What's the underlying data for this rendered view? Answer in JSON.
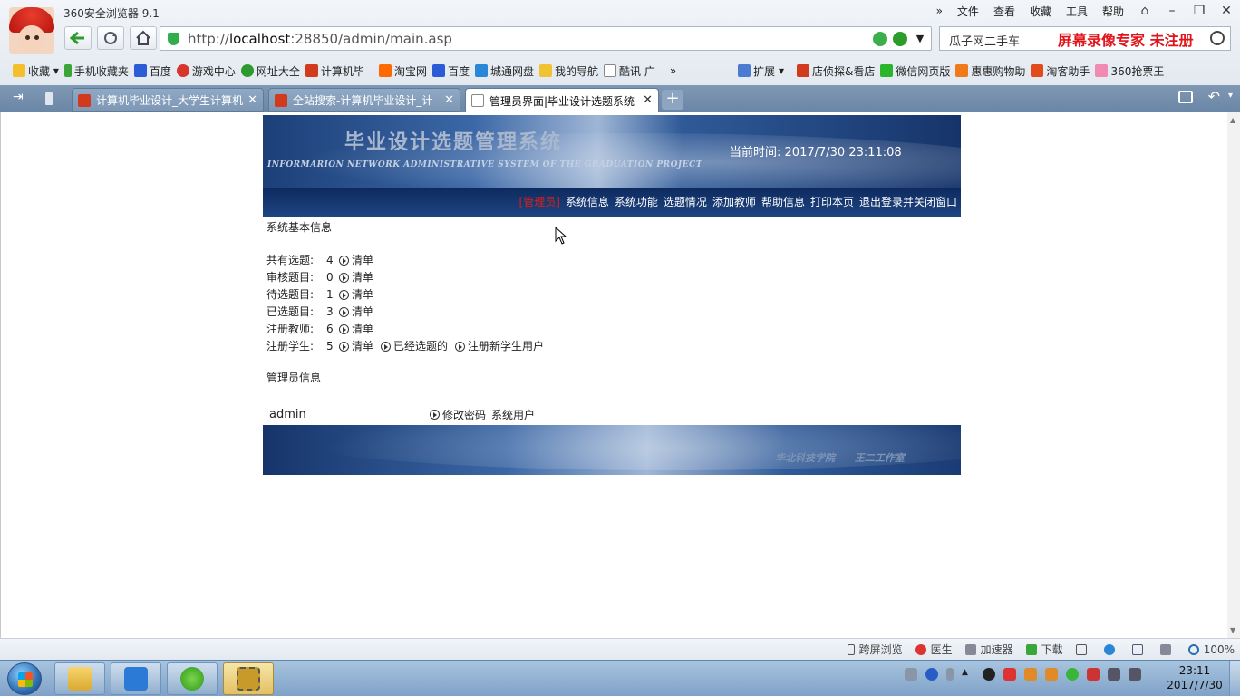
{
  "browser": {
    "app_title": "360安全浏览器 9.1",
    "menu": [
      "文件",
      "查看",
      "收藏",
      "工具",
      "帮助"
    ],
    "url_prefix": "http://",
    "url_host": "localhost",
    "url_rest": ":28850/admin/main.asp",
    "search_text": "瓜子网二手车",
    "recorder_watermark": "屏幕录像专家  未注册",
    "bookmarks": [
      "收藏",
      "手机收藏夹",
      "百度",
      "游戏中心",
      "网址大全",
      "计算机毕",
      "淘宝网",
      "百度",
      "城通网盘",
      "我的导航",
      "酷讯 广"
    ],
    "bookmarks_right": [
      "扩展",
      "店侦探&看店",
      "微信网页版",
      "惠惠购物助",
      "淘客助手",
      "360抢票王"
    ],
    "tabs": [
      {
        "label": "计算机毕业设计_大学生计算机"
      },
      {
        "label": "全站搜索-计算机毕业设计_计"
      },
      {
        "label": "管理员界面|毕业设计选题系统"
      }
    ],
    "status_items": [
      "跨屏浏览",
      "医生",
      "加速器",
      "下载",
      "100%"
    ]
  },
  "page": {
    "banner_title": "毕业设计选题管理系统",
    "banner_subtitle": "INFORMARION NETWORK ADMINISTRATIVE SYSTEM OF THE GRADUATION PROJECT",
    "time_label": "当前时间:",
    "time_value": "2017/7/30 23:11:08",
    "nav": {
      "current": "[管理员]",
      "links": [
        "系统信息",
        "系统功能",
        "选题情况",
        "添加教师",
        "帮助信息",
        "打印本页",
        "退出登录并关闭窗口"
      ]
    },
    "basic_info_title": "系统基本信息",
    "stats": [
      {
        "label": "共有选题:",
        "value": "4",
        "links": [
          "清单"
        ]
      },
      {
        "label": "审核题目:",
        "value": "0",
        "links": [
          "清单"
        ]
      },
      {
        "label": "待选题目:",
        "value": "1",
        "links": [
          "清单"
        ]
      },
      {
        "label": "已选题目:",
        "value": "3",
        "links": [
          "清单"
        ]
      },
      {
        "label": "注册教师:",
        "value": "6",
        "links": [
          "清单"
        ]
      },
      {
        "label": "注册学生:",
        "value": "5",
        "links": [
          "清单",
          "已经选题的",
          "注册新学生用户"
        ]
      }
    ],
    "admin_info_title": "管理员信息",
    "admin_name": "admin",
    "change_password": "修改密码",
    "system_user": "系统用户",
    "footer_credit": "华北科技学院 王二工作室"
  },
  "taskbar": {
    "clock_time": "23:11",
    "clock_date": "2017/7/30"
  }
}
